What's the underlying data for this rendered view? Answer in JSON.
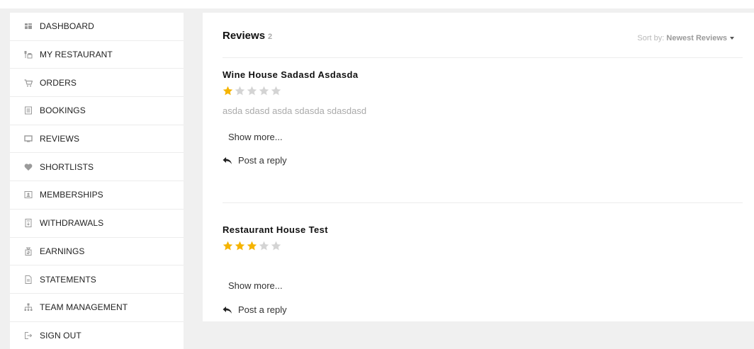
{
  "sidebar": {
    "items": [
      {
        "label": "DASHBOARD",
        "icon": "dashboard-icon"
      },
      {
        "label": "MY RESTAURANT",
        "icon": "restaurant-icon"
      },
      {
        "label": "ORDERS",
        "icon": "cart-icon"
      },
      {
        "label": "BOOKINGS",
        "icon": "bookings-icon"
      },
      {
        "label": "REVIEWS",
        "icon": "reviews-icon"
      },
      {
        "label": "SHORTLISTS",
        "icon": "heart-icon"
      },
      {
        "label": "MEMBERSHIPS",
        "icon": "membership-icon"
      },
      {
        "label": "WITHDRAWALS",
        "icon": "withdrawals-icon"
      },
      {
        "label": "EARNINGS",
        "icon": "earnings-icon"
      },
      {
        "label": "STATEMENTS",
        "icon": "statements-icon"
      },
      {
        "label": "TEAM MANAGEMENT",
        "icon": "team-icon"
      },
      {
        "label": "SIGN OUT",
        "icon": "sign-out-icon"
      }
    ]
  },
  "reviews": {
    "title": "Reviews",
    "count": "2",
    "sort_label": "Sort by:",
    "sort_value": "Newest Reviews",
    "items": [
      {
        "title": "Wine House Sadasd Asdasda",
        "rating": 1,
        "max_rating": 5,
        "text": "asda sdasd asda sdasda sdasdasd",
        "show_more": "Show more...",
        "reply": "Post a reply"
      },
      {
        "title": "Restaurant House Test",
        "rating": 3,
        "max_rating": 5,
        "text": "",
        "show_more": "Show more...",
        "reply": "Post a reply"
      }
    ]
  },
  "colors": {
    "star_filled": "#f5b400",
    "star_empty": "#d4d4d4",
    "background": "#f0f0f0",
    "panel": "#ffffff"
  }
}
